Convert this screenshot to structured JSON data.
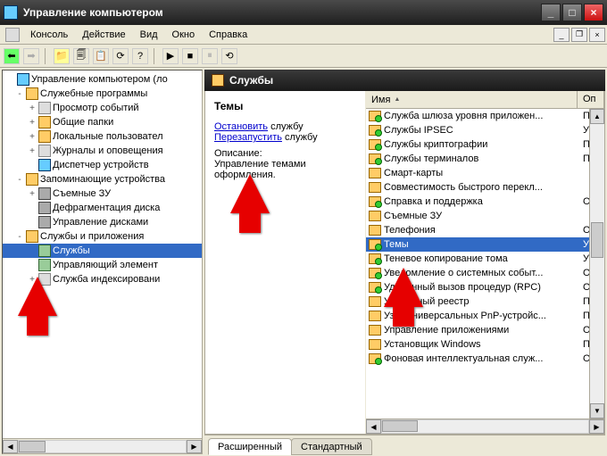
{
  "window": {
    "title": "Управление компьютером"
  },
  "menubar": {
    "items": [
      "Консоль",
      "Действие",
      "Вид",
      "Окно",
      "Справка"
    ]
  },
  "tree": {
    "root": "Управление компьютером (ло",
    "group1": {
      "label": "Служебные программы",
      "children": [
        "Просмотр событий",
        "Общие папки",
        "Локальные пользовател",
        "Журналы и оповещения",
        "Диспетчер устройств"
      ]
    },
    "group2": {
      "label": "Запоминающие устройства",
      "children": [
        "Съемные ЗУ",
        "Дефрагментация диска",
        "Управление дисками"
      ]
    },
    "group3": {
      "label": "Службы и приложения",
      "children": [
        "Службы",
        "Управляющий элемент",
        "Служба индексировани"
      ]
    }
  },
  "header": {
    "title": "Службы"
  },
  "desc": {
    "selected_name": "Темы",
    "stop_link": "Остановить",
    "stop_suffix": " службу",
    "restart_link": "Перезапустить",
    "restart_suffix": " службу",
    "desc_label": "Описание:",
    "desc_text": "Управление темами оформления."
  },
  "list": {
    "col_name": "Имя",
    "col2": "Оп",
    "rows": [
      {
        "name": "Служба шлюза уровня приложен...",
        "c2": "По",
        "running": true
      },
      {
        "name": "Службы IPSEC",
        "c2": "Уп",
        "running": true
      },
      {
        "name": "Службы криптографии",
        "c2": "Пр",
        "running": true
      },
      {
        "name": "Службы терминалов",
        "c2": "По",
        "running": true
      },
      {
        "name": "Смарт-карты",
        "c2": "",
        "running": false
      },
      {
        "name": "Совместимость быстрого перекл...",
        "c2": "",
        "running": false
      },
      {
        "name": "Справка и поддержка",
        "c2": "Об",
        "running": true
      },
      {
        "name": "Съемные ЗУ",
        "c2": "",
        "running": false
      },
      {
        "name": "Телефония",
        "c2": "Об",
        "running": false
      },
      {
        "name": "Темы",
        "c2": "Уп",
        "running": true
      },
      {
        "name": "Теневое копирование тома",
        "c2": "Уп",
        "running": true
      },
      {
        "name": "Уведомление о системных событ...",
        "c2": "От",
        "running": true
      },
      {
        "name": "Удаленный вызов процедур (RPC)",
        "c2": "Об",
        "running": true
      },
      {
        "name": "Удаленный реестр",
        "c2": "По",
        "running": false
      },
      {
        "name": "Узел универсальных PnP-устройс...",
        "c2": "По",
        "running": false
      },
      {
        "name": "Управление приложениями",
        "c2": "Об",
        "running": false
      },
      {
        "name": "Установщик Windows",
        "c2": "По",
        "running": false
      },
      {
        "name": "Фоновая интеллектуальная служ...",
        "c2": "Об",
        "running": true
      }
    ]
  },
  "tabs": {
    "extended": "Расширенный",
    "standard": "Стандартный"
  }
}
